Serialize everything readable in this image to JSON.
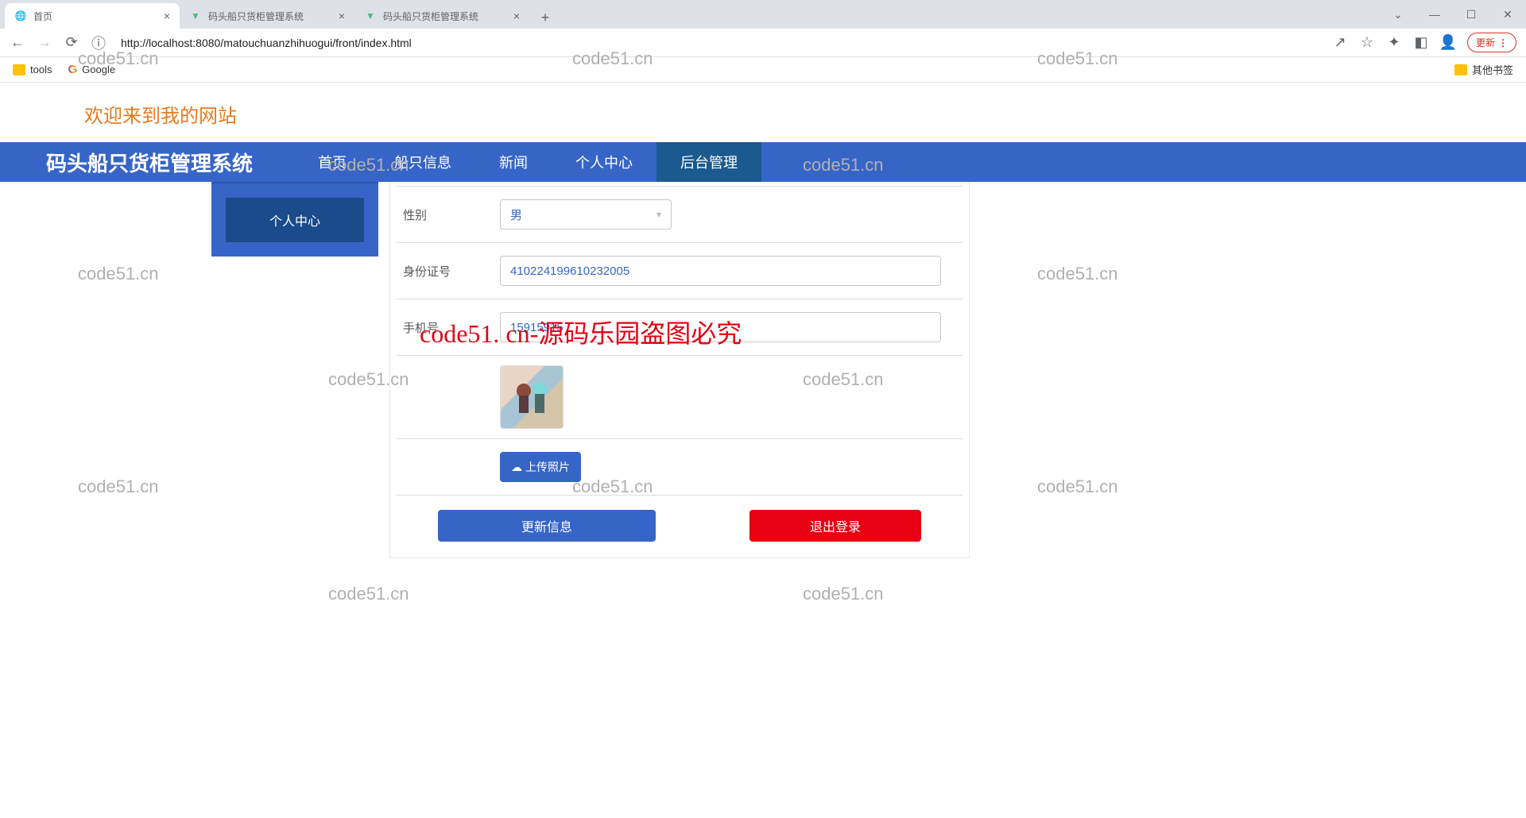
{
  "browser": {
    "tabs": [
      {
        "title": "首页",
        "active": true,
        "favicon": "globe"
      },
      {
        "title": "码头船只货柜管理系统",
        "active": false,
        "favicon": "vue"
      },
      {
        "title": "码头船只货柜管理系统",
        "active": false,
        "favicon": "vue"
      }
    ],
    "url": "http://localhost:8080/matouchuanzhihuogui/front/index.html",
    "update_label": "更新",
    "bookmarks": {
      "tools": "tools",
      "google": "Google",
      "other": "其他书签"
    }
  },
  "page": {
    "welcome": "欢迎来到我的网站",
    "brand": "码头船只货柜管理系统",
    "nav": [
      "首页",
      "船只信息",
      "新闻",
      "个人中心",
      "后台管理"
    ],
    "sidebar": {
      "item1": "个人中心"
    },
    "form": {
      "gender_label": "性别",
      "gender_value": "男",
      "idcard_label": "身份证号",
      "idcard_value": "410224199610232005",
      "phone_label": "手机号",
      "phone_value": "15915915",
      "upload_label": "上传照片",
      "update_btn": "更新信息",
      "logout_btn": "退出登录"
    }
  },
  "watermarks": {
    "light": "code51.cn",
    "red": "code51. cn-源码乐园盗图必究"
  }
}
